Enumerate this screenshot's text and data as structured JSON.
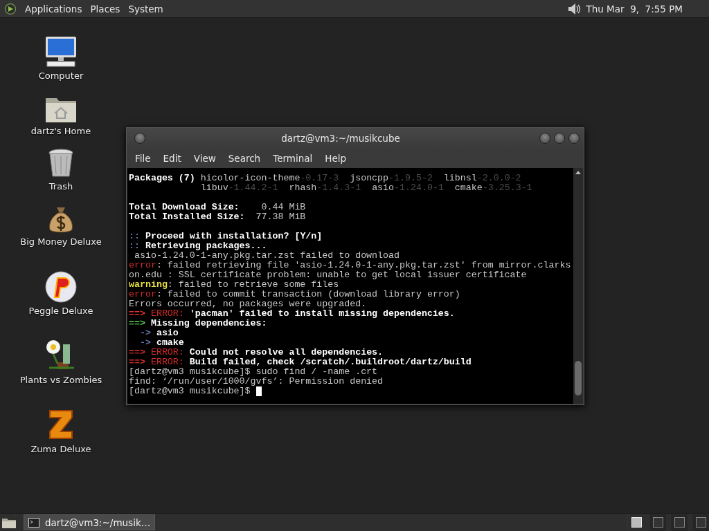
{
  "top_panel": {
    "menus": [
      "Applications",
      "Places",
      "System"
    ],
    "clock": "Thu Mar  9,  7:55 PM"
  },
  "desktop_icons": [
    {
      "label": "Computer",
      "kind": "computer"
    },
    {
      "label": "dartz's Home",
      "kind": "home"
    },
    {
      "label": "Trash",
      "kind": "trash"
    },
    {
      "label": "Big Money Deluxe",
      "kind": "moneybag"
    },
    {
      "label": "Peggle Deluxe",
      "kind": "ball"
    },
    {
      "label": "Plants vs Zombies",
      "kind": "flower"
    },
    {
      "label": "Zuma Deluxe",
      "kind": "block"
    }
  ],
  "terminal": {
    "title": "dartz@vm3:~/musikcube",
    "menus": [
      "File",
      "Edit",
      "View",
      "Search",
      "Terminal",
      "Help"
    ],
    "blocks": [
      [
        [
          {
            "text": "Packages (7) ",
            "kind": "bold"
          },
          {
            "text": "hicolor-icon-theme",
            "kind": "plain"
          },
          {
            "text": "-0.17-3",
            "kind": "dim"
          },
          {
            "text": "  jsoncpp",
            "kind": "plain"
          },
          {
            "text": "-1.9.5-2",
            "kind": "dim"
          },
          {
            "text": "  libnsl",
            "kind": "plain"
          },
          {
            "text": "-2.0.0-2",
            "kind": "dim"
          }
        ],
        [
          {
            "text": "             libuv",
            "kind": "plain"
          },
          {
            "text": "-1.44.2-1",
            "kind": "dim"
          },
          {
            "text": "  rhash",
            "kind": "plain"
          },
          {
            "text": "-1.4.3-1",
            "kind": "dim"
          },
          {
            "text": "  asio",
            "kind": "plain"
          },
          {
            "text": "-1.24.0-1",
            "kind": "dim"
          },
          {
            "text": "  cmake",
            "kind": "plain"
          },
          {
            "text": "-3.25.3-1",
            "kind": "dim"
          }
        ]
      ],
      [
        [
          {
            "text": "Total Download Size:    ",
            "kind": "bold"
          },
          {
            "text": "0.44 MiB",
            "kind": "plain"
          }
        ],
        [
          {
            "text": "Total Installed Size:  ",
            "kind": "bold"
          },
          {
            "text": "77.38 MiB",
            "kind": "plain"
          }
        ]
      ],
      [
        [
          {
            "text": ":: ",
            "kind": "blue"
          },
          {
            "text": "Proceed with installation? [Y/n]",
            "kind": "bold"
          }
        ],
        [
          {
            "text": ":: ",
            "kind": "blue"
          },
          {
            "text": "Retrieving packages...",
            "kind": "bold"
          }
        ],
        [
          {
            "text": " asio-1.24.0-1-any.pkg.tar.zst failed to download",
            "kind": "plain"
          }
        ],
        [
          {
            "text": "error",
            "kind": "red"
          },
          {
            "text": ": failed retrieving file 'asio-1.24.0-1-any.pkg.tar.zst' from mirror.clarks",
            "kind": "plain"
          }
        ],
        [
          {
            "text": "on.edu : SSL certificate problem: unable to get local issuer certificate",
            "kind": "plain"
          }
        ],
        [
          {
            "text": "warning",
            "kind": "yellow"
          },
          {
            "text": ": failed to retrieve some files",
            "kind": "plain"
          }
        ],
        [
          {
            "text": "error",
            "kind": "red"
          },
          {
            "text": ": failed to commit transaction (download library error)",
            "kind": "plain"
          }
        ],
        [
          {
            "text": "Errors occurred, no packages were upgraded.",
            "kind": "plain"
          }
        ],
        [
          {
            "text": "==> ",
            "kind": "redbold"
          },
          {
            "text": "ERROR:",
            "kind": "red"
          },
          {
            "text": " 'pacman' failed to install missing dependencies.",
            "kind": "bold"
          }
        ],
        [
          {
            "text": "==> ",
            "kind": "greenbold"
          },
          {
            "text": "Missing dependencies:",
            "kind": "bold"
          }
        ],
        [
          {
            "text": "  -> ",
            "kind": "blue"
          },
          {
            "text": "asio",
            "kind": "bold"
          }
        ],
        [
          {
            "text": "  -> ",
            "kind": "blue"
          },
          {
            "text": "cmake",
            "kind": "bold"
          }
        ],
        [
          {
            "text": "==> ",
            "kind": "redbold"
          },
          {
            "text": "ERROR:",
            "kind": "red"
          },
          {
            "text": " Could not resolve all dependencies.",
            "kind": "bold"
          }
        ],
        [
          {
            "text": "==> ",
            "kind": "redbold"
          },
          {
            "text": "ERROR:",
            "kind": "red"
          },
          {
            "text": " Build failed, check /scratch/.buildroot/dartz/build",
            "kind": "bold"
          }
        ],
        [
          {
            "text": "[dartz@vm3 musikcube]$ sudo find / -name .crt",
            "kind": "plain"
          }
        ],
        [
          {
            "text": "find: ‘/run/user/1000/gvfs’: Permission denied",
            "kind": "plain"
          }
        ],
        [
          {
            "text": "[dartz@vm3 musikcube]$ ",
            "kind": "plain"
          }
        ]
      ]
    ]
  },
  "taskbar": {
    "windows": [
      {
        "label": "dartz@vm3:~/musik…"
      }
    ],
    "workspaces": [
      {
        "selected": true
      },
      {
        "selected": false
      },
      {
        "selected": false
      },
      {
        "selected": false
      }
    ]
  }
}
